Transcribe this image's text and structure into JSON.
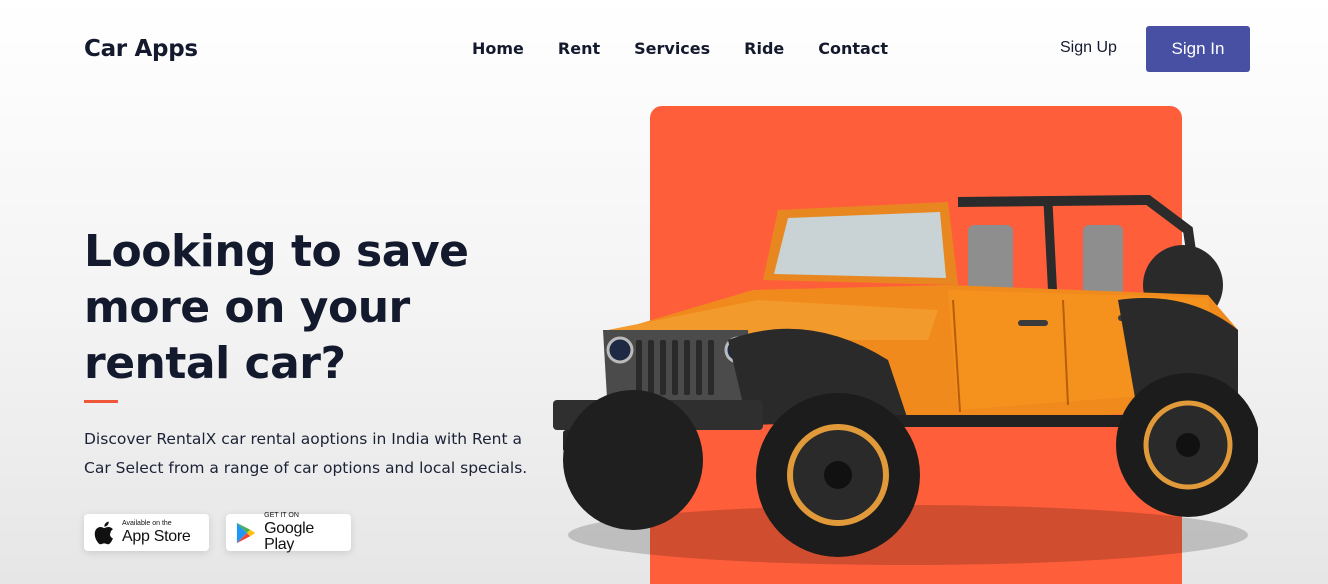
{
  "brand": {
    "logo": "Car Apps"
  },
  "nav": {
    "items": [
      {
        "label": "Home"
      },
      {
        "label": "Rent"
      },
      {
        "label": "Services"
      },
      {
        "label": "Ride"
      },
      {
        "label": "Contact"
      }
    ]
  },
  "auth": {
    "signup_label": "Sign Up",
    "signin_label": "Sign In"
  },
  "hero": {
    "headline": "Looking to save more on your rental car?",
    "description": "Discover RentalX car rental aoptions in India with Rent a Car Select from a range of car options and local specials."
  },
  "stores": {
    "apple": {
      "small": "Available on the",
      "big": "App Store",
      "icon": "apple-icon"
    },
    "google": {
      "small": "GET IT ON",
      "big": "Google Play",
      "icon": "google-play-icon"
    }
  },
  "colors": {
    "primary": "#4850a4",
    "accent": "#ff5e3a",
    "jeep_body": "#f08a1c",
    "text": "#141a2e"
  }
}
